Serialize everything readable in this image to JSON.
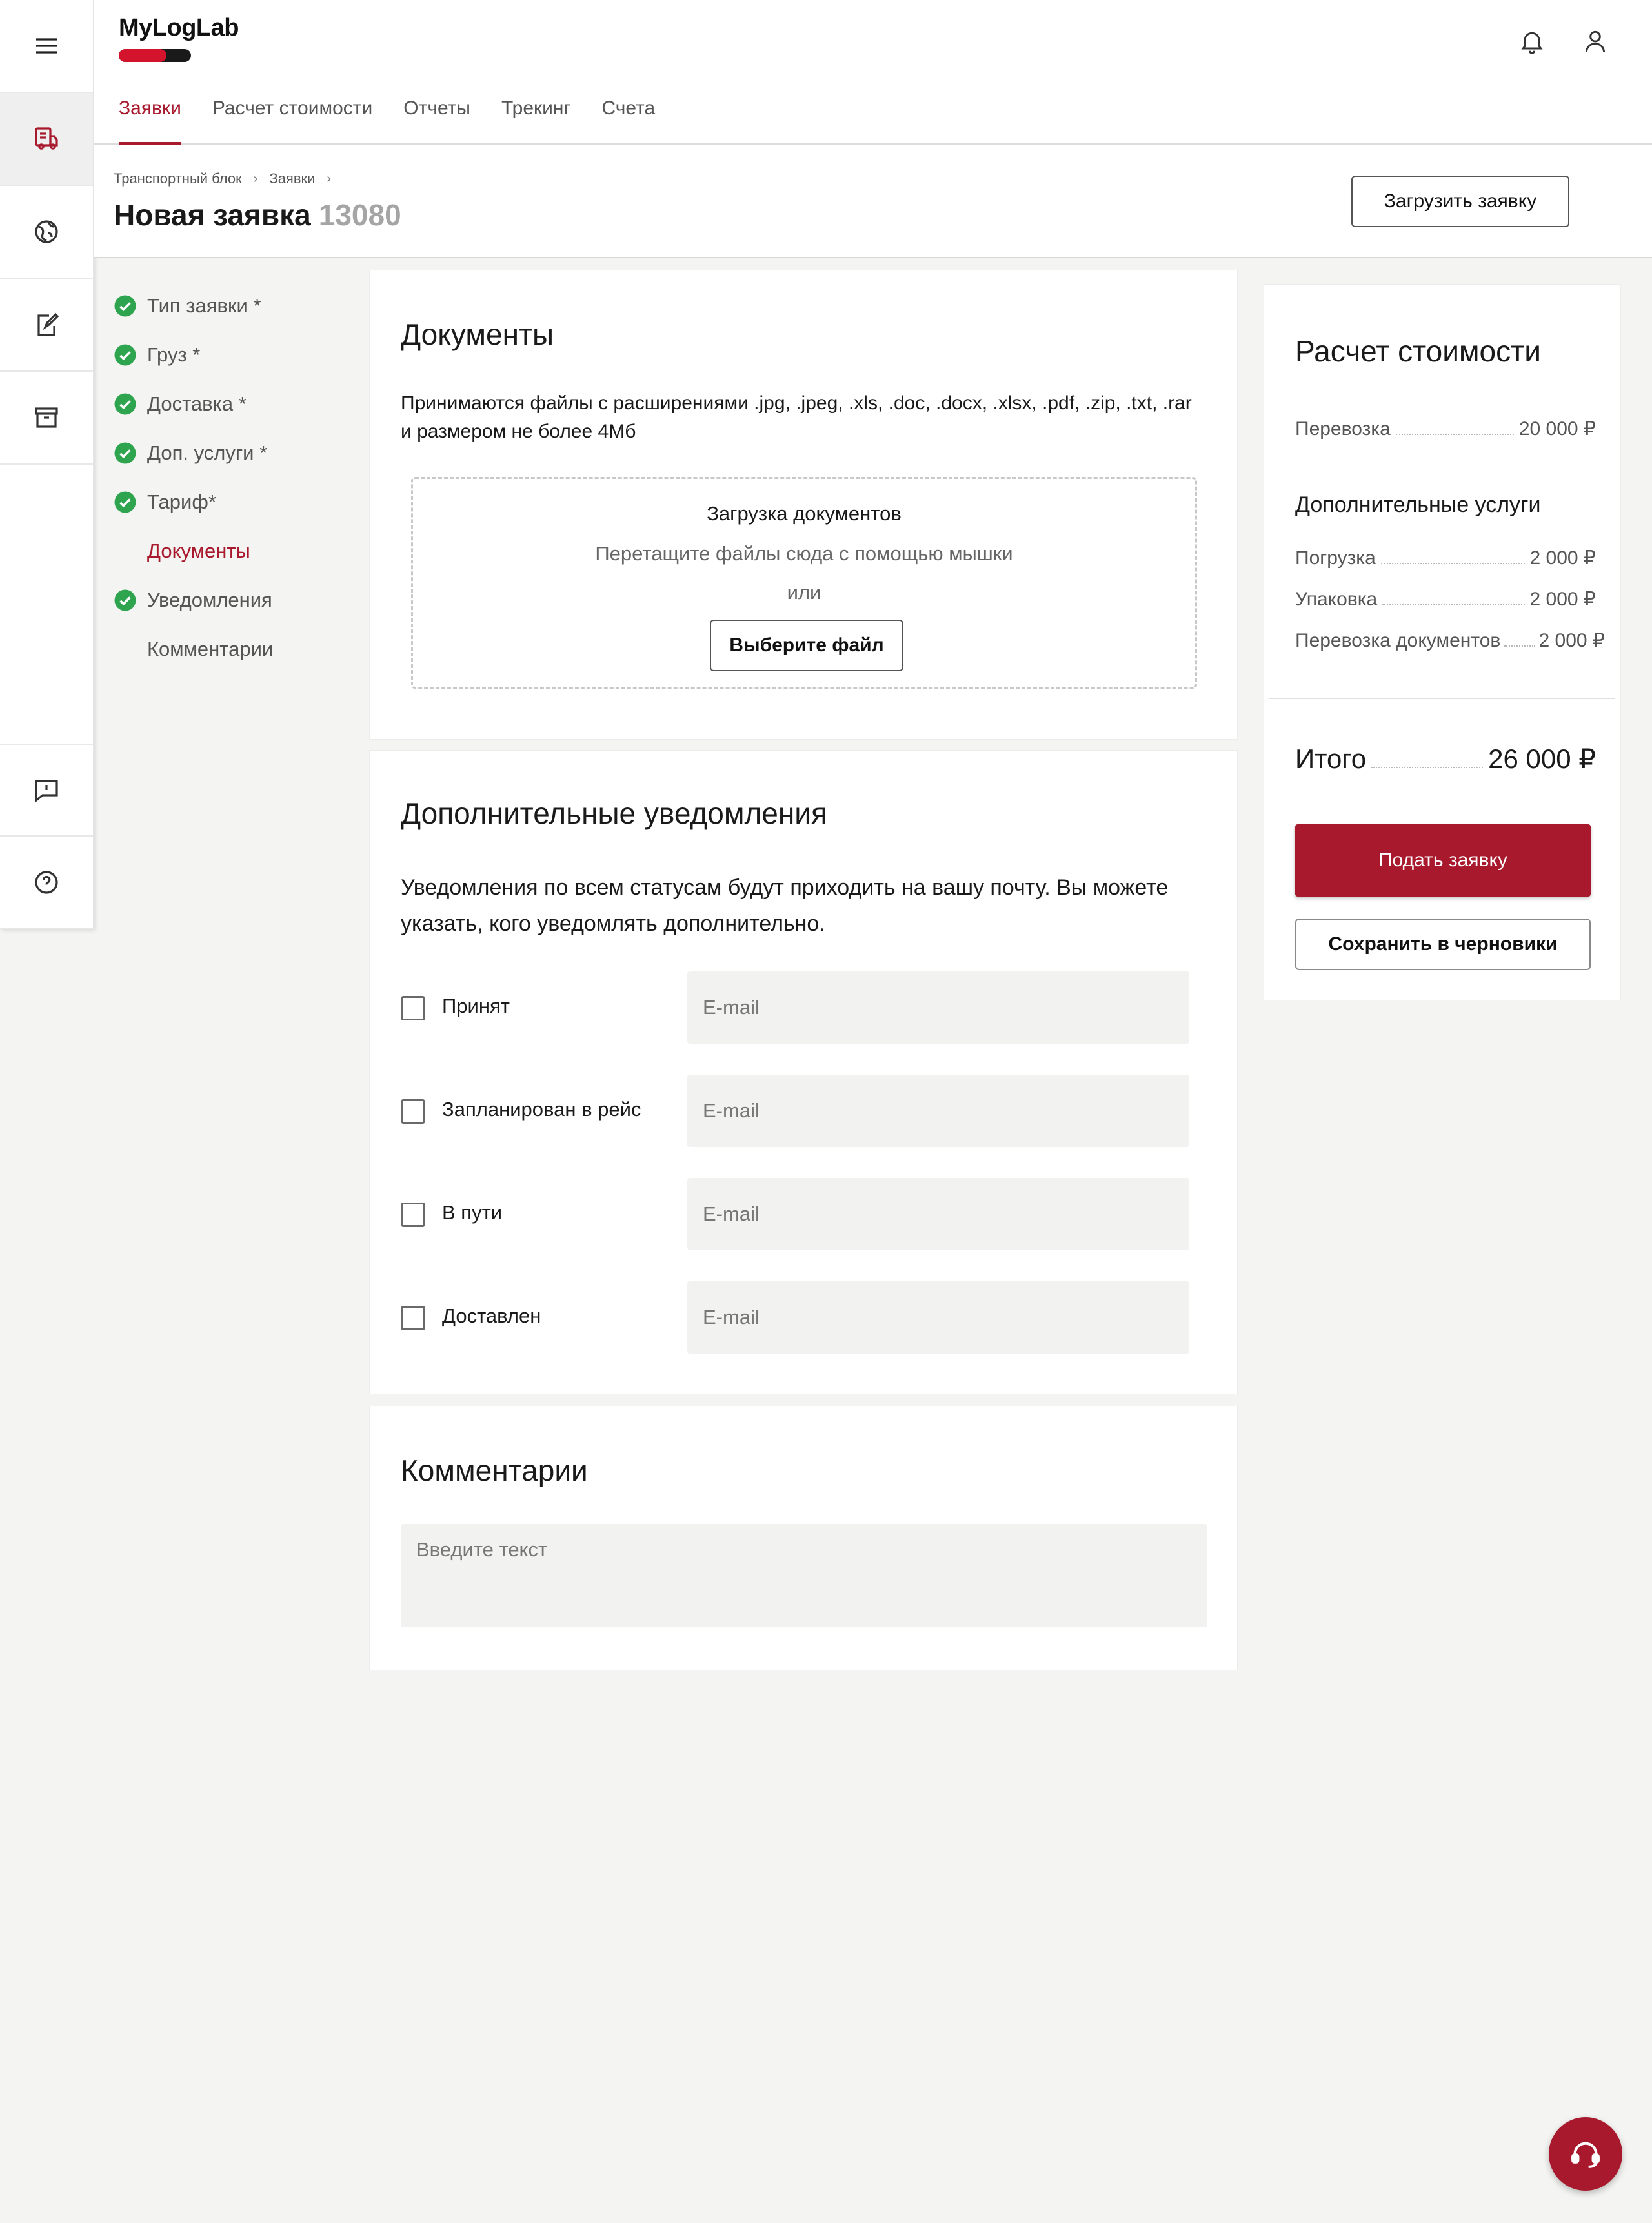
{
  "app": {
    "logo": "MyLogLab",
    "brand_color": "#a8192d"
  },
  "header": {
    "tabs": [
      {
        "label": "Заявки",
        "active": true
      },
      {
        "label": "Расчет стоимости",
        "active": false
      },
      {
        "label": "Отчеты",
        "active": false
      },
      {
        "label": "Трекинг",
        "active": false
      },
      {
        "label": "Счета",
        "active": false
      }
    ],
    "icons": [
      "bell-icon",
      "user-icon"
    ]
  },
  "rail": {
    "icons": [
      "menu-icon",
      "truck-document-icon",
      "globe-icon",
      "edit-document-icon",
      "archive-icon",
      "feedback-icon",
      "help-icon"
    ]
  },
  "breadcrumb": [
    "Транспортный блок",
    "Заявки"
  ],
  "page": {
    "title": "Новая заявка",
    "number": "13080",
    "upload_button": "Загрузить заявку"
  },
  "steps": [
    {
      "label": "Тип заявки *",
      "done": true
    },
    {
      "label": "Груз *",
      "done": true
    },
    {
      "label": "Доставка *",
      "done": true
    },
    {
      "label": "Доп. услуги *",
      "done": true
    },
    {
      "label": "Тариф*",
      "done": true
    },
    {
      "label": "Документы",
      "done": false,
      "active": true
    },
    {
      "label": "Уведомления",
      "done": true
    },
    {
      "label": "Комментарии",
      "done": false
    }
  ],
  "documents": {
    "title": "Документы",
    "description": "Принимаются файлы с расширениями .jpg, .jpeg, .xls, .doc, .docx, .xlsx, .pdf, .zip, .txt, .rar и размером не более 4Мб",
    "dropzone_title": "Загрузка документов",
    "dropzone_hint": "Перетащите файлы сюда с помощью мышки",
    "dropzone_or": "или",
    "choose_button": "Выберите файл"
  },
  "notifications": {
    "title": "Дополнительные уведомления",
    "description": "Уведомления по всем статусам будут приходить на вашу почту. Вы можете указать, кого уведомлять дополнительно.",
    "rows": [
      {
        "label": "Принят",
        "placeholder": "E-mail",
        "checked": false
      },
      {
        "label": "Запланирован в рейс",
        "placeholder": "E-mail",
        "checked": false
      },
      {
        "label": "В пути",
        "placeholder": "E-mail",
        "checked": false
      },
      {
        "label": "Доставлен",
        "placeholder": "E-mail",
        "checked": false
      }
    ]
  },
  "comments": {
    "title": "Комментарии",
    "placeholder": "Введите текст"
  },
  "cost": {
    "title": "Расчет стоимости",
    "transport": {
      "label": "Перевозка",
      "value": "20 000 ₽"
    },
    "extra_title": "Дополнительные услуги",
    "extras": [
      {
        "label": "Погрузка",
        "value": "2 000 ₽"
      },
      {
        "label": "Упаковка",
        "value": "2 000 ₽"
      },
      {
        "label": "Перевозка документов",
        "value": "2 000 ₽"
      }
    ],
    "total_label": "Итого",
    "total_value": "26 000 ₽",
    "submit_button": "Подать заявку",
    "draft_button": "Сохранить в черновики"
  }
}
